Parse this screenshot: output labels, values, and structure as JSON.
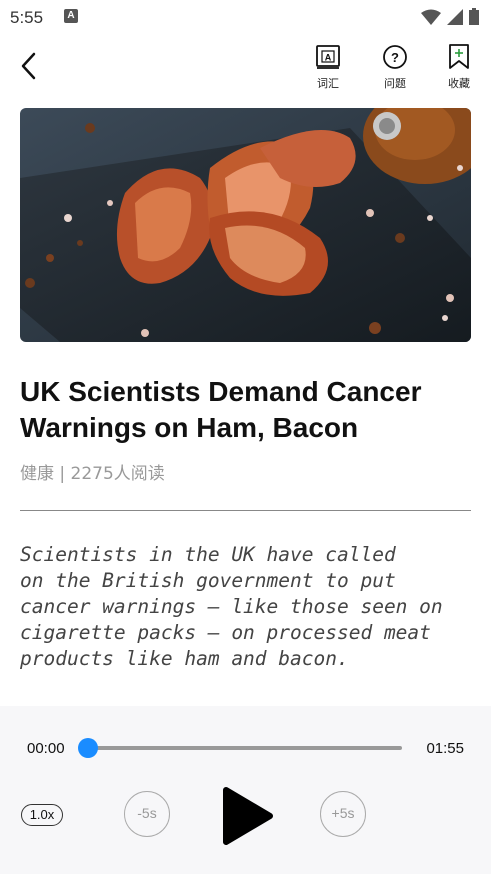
{
  "status": {
    "time": "5:55"
  },
  "toolbar": {
    "vocab_label": "词汇",
    "question_label": "问题",
    "favorite_label": "收藏"
  },
  "article": {
    "title": "UK Scientists Demand Cancer Warnings on Ham, Bacon",
    "meta": "健康 | 2275人阅读",
    "excerpt": "Scientists in the UK have called\non the British government to put\ncancer warnings — like those seen on\ncigarette packs — on processed meat\nproducts like ham and bacon."
  },
  "player": {
    "current_time": "00:00",
    "total_time": "01:55",
    "progress": 0,
    "speed_label": "1.0x",
    "rewind_label": "-5s",
    "forward_label": "+5s"
  },
  "colors": {
    "accent": "#1a8cff"
  }
}
